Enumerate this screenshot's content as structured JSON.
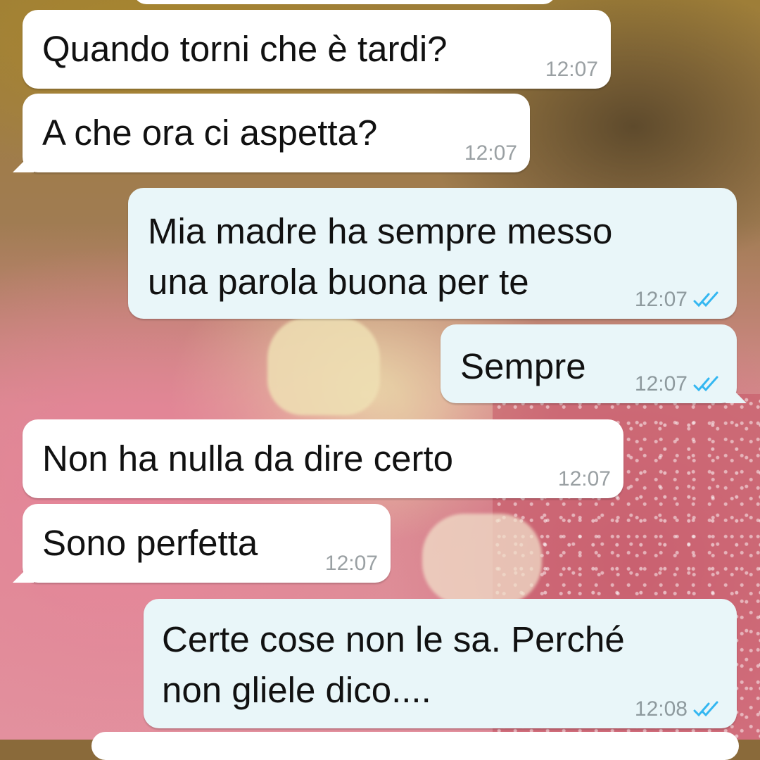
{
  "colors": {
    "incoming_bubble": "#ffffff",
    "outgoing_bubble": "#e9f6f9",
    "timestamp": "#9aa0a3",
    "read_ticks": "#34b7f1"
  },
  "messages": [
    {
      "direction": "in",
      "text": "Quando torni che è tardi?",
      "time": "12:07"
    },
    {
      "direction": "in",
      "text": "A che ora ci aspetta?",
      "time": "12:07"
    },
    {
      "direction": "out",
      "text": "Mia madre ha sempre messo\nuna parola buona per te",
      "time": "12:07",
      "status": "read"
    },
    {
      "direction": "out",
      "text": "Sempre",
      "time": "12:07",
      "status": "read"
    },
    {
      "direction": "in",
      "text": "Non ha nulla da dire certo",
      "time": "12:07"
    },
    {
      "direction": "in",
      "text": "Sono perfetta",
      "time": "12:07"
    },
    {
      "direction": "out",
      "text": "Certe cose non le sa. Perché\nnon gliele dico....",
      "time": "12:08",
      "status": "read"
    }
  ]
}
